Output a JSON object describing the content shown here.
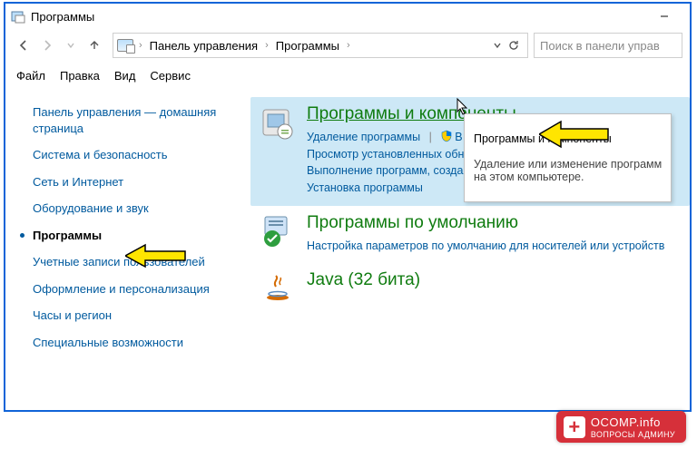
{
  "title": "Программы",
  "breadcrumb": [
    "Панель управления",
    "Программы"
  ],
  "search_placeholder": "Поиск в панели управ",
  "menu": [
    "Файл",
    "Правка",
    "Вид",
    "Сервис"
  ],
  "sidebar": {
    "items": [
      {
        "label": "Панель управления — домашняя страница"
      },
      {
        "label": "Система и безопасность"
      },
      {
        "label": "Сеть и Интернет"
      },
      {
        "label": "Оборудование и звук"
      },
      {
        "label": "Программы",
        "current": true
      },
      {
        "label": "Учетные записи пользователей"
      },
      {
        "label": "Оформление и персонализация"
      },
      {
        "label": "Часы и регион"
      },
      {
        "label": "Специальные возможности"
      }
    ]
  },
  "categories": [
    {
      "title": "Программы и компоненты",
      "links": [
        "Удаление программы",
        "В",
        "Просмотр установленных обно",
        "Выполнение программ, создан",
        "Установка программы"
      ]
    },
    {
      "title": "Программы по умолчанию",
      "links": [
        "Настройка параметров по умолчанию для носителей или устройств"
      ]
    },
    {
      "title": "Java (32 бита)",
      "links": []
    }
  ],
  "tooltip": {
    "title": "Программы и компоненты",
    "body": "Удаление или изменение программ\nна этом компьютере."
  },
  "watermark": {
    "l1a": "OCOMP",
    "l1b": ".info",
    "l2": "ВОПРОСЫ АДМИНУ"
  }
}
